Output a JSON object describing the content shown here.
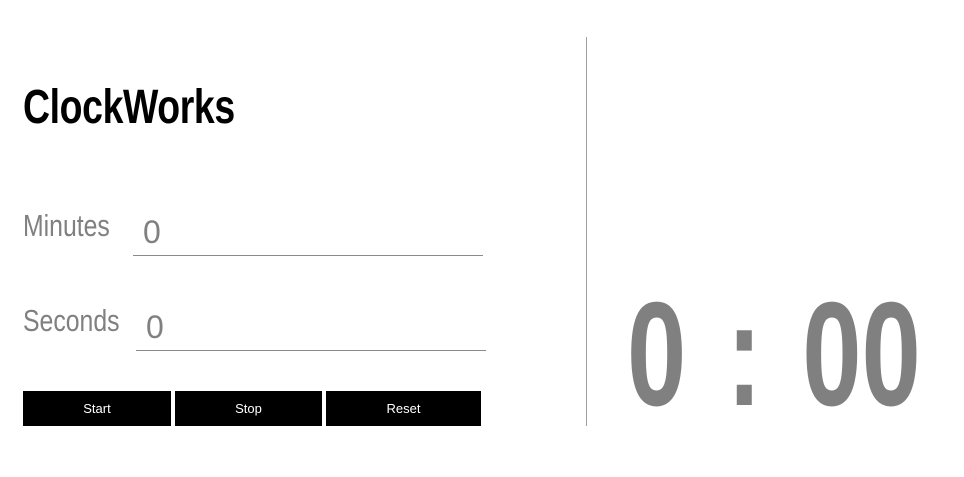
{
  "app": {
    "title": "ClockWorks"
  },
  "form": {
    "minutes_label": "Minutes",
    "minutes_value": "0",
    "seconds_label": "Seconds",
    "seconds_value": "0"
  },
  "controls": {
    "start_label": "Start",
    "stop_label": "Stop",
    "reset_label": "Reset"
  },
  "timer": {
    "minutes": "0",
    "separator": ":",
    "seconds": "00"
  },
  "colors": {
    "text_primary": "#000000",
    "text_muted": "#808080",
    "button_bg": "#000000",
    "button_text": "#ffffff",
    "divider": "#a0a0a0"
  }
}
